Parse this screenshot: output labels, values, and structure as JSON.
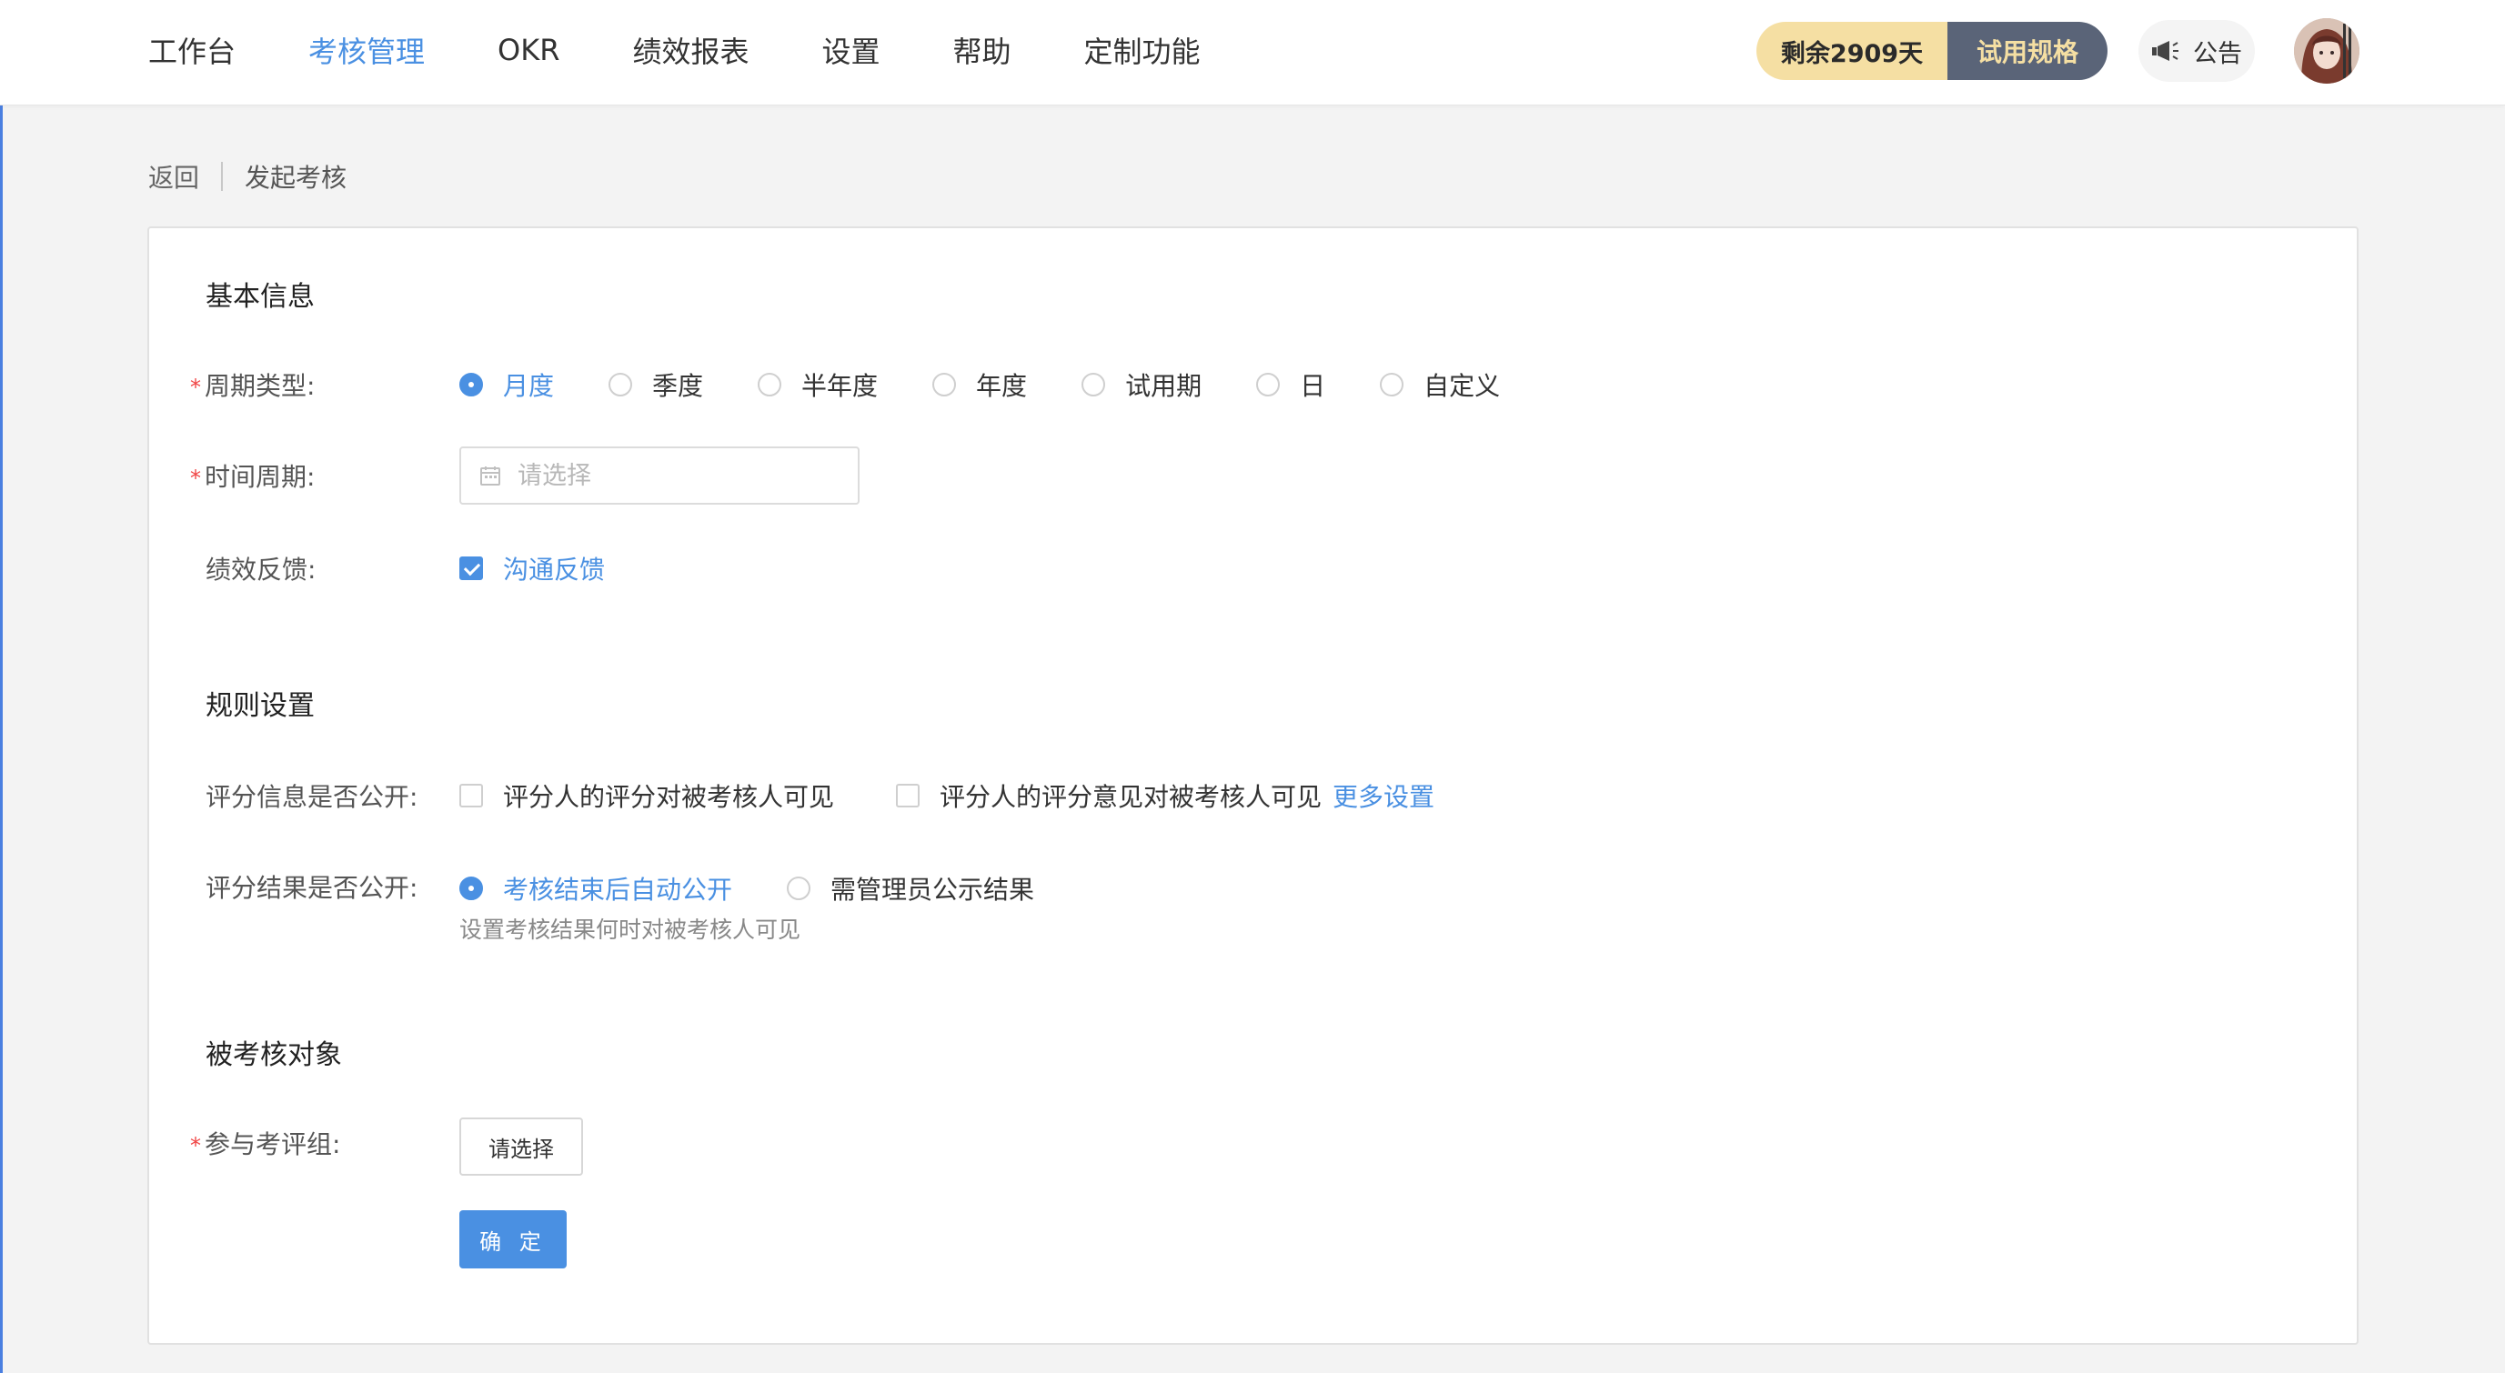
{
  "nav": {
    "items": [
      {
        "label": "工作台",
        "active": false
      },
      {
        "label": "考核管理",
        "active": true
      },
      {
        "label": "OKR",
        "active": false
      },
      {
        "label": "绩效报表",
        "active": false
      },
      {
        "label": "设置",
        "active": false
      },
      {
        "label": "帮助",
        "active": false
      },
      {
        "label": "定制功能",
        "active": false
      }
    ]
  },
  "header": {
    "remaining_days": "剩余2909天",
    "plan_label": "试用规格",
    "notice_label": "公告"
  },
  "breadcrumb": {
    "back": "返回",
    "current": "发起考核"
  },
  "basic_info": {
    "title": "基本信息",
    "cycle_type": {
      "label": "周期类型:",
      "options": [
        "月度",
        "季度",
        "半年度",
        "年度",
        "试用期",
        "日",
        "自定义"
      ],
      "selected": "月度"
    },
    "time_period": {
      "label": "时间周期:",
      "placeholder": "请选择"
    },
    "feedback": {
      "label": "绩效反馈:",
      "option": "沟通反馈",
      "checked": true
    }
  },
  "rules": {
    "title": "规则设置",
    "score_info_public": {
      "label": "评分信息是否公开:",
      "options": [
        "评分人的评分对被考核人可见",
        "评分人的评分意见对被考核人可见"
      ],
      "more_link": "更多设置"
    },
    "score_result_public": {
      "label": "评分结果是否公开:",
      "options": [
        "考核结束后自动公开",
        "需管理员公示结果"
      ],
      "selected": "考核结束后自动公开",
      "hint": "设置考核结果何时对被考核人可见"
    }
  },
  "targets": {
    "title": "被考核对象",
    "group": {
      "label": "参与考评组:",
      "button": "请选择"
    },
    "confirm": "确 定"
  },
  "colors": {
    "accent": "#4a90e2",
    "required": "#f04545",
    "plan_gold": "#f5dfa3",
    "plan_dark": "#5a6478"
  }
}
